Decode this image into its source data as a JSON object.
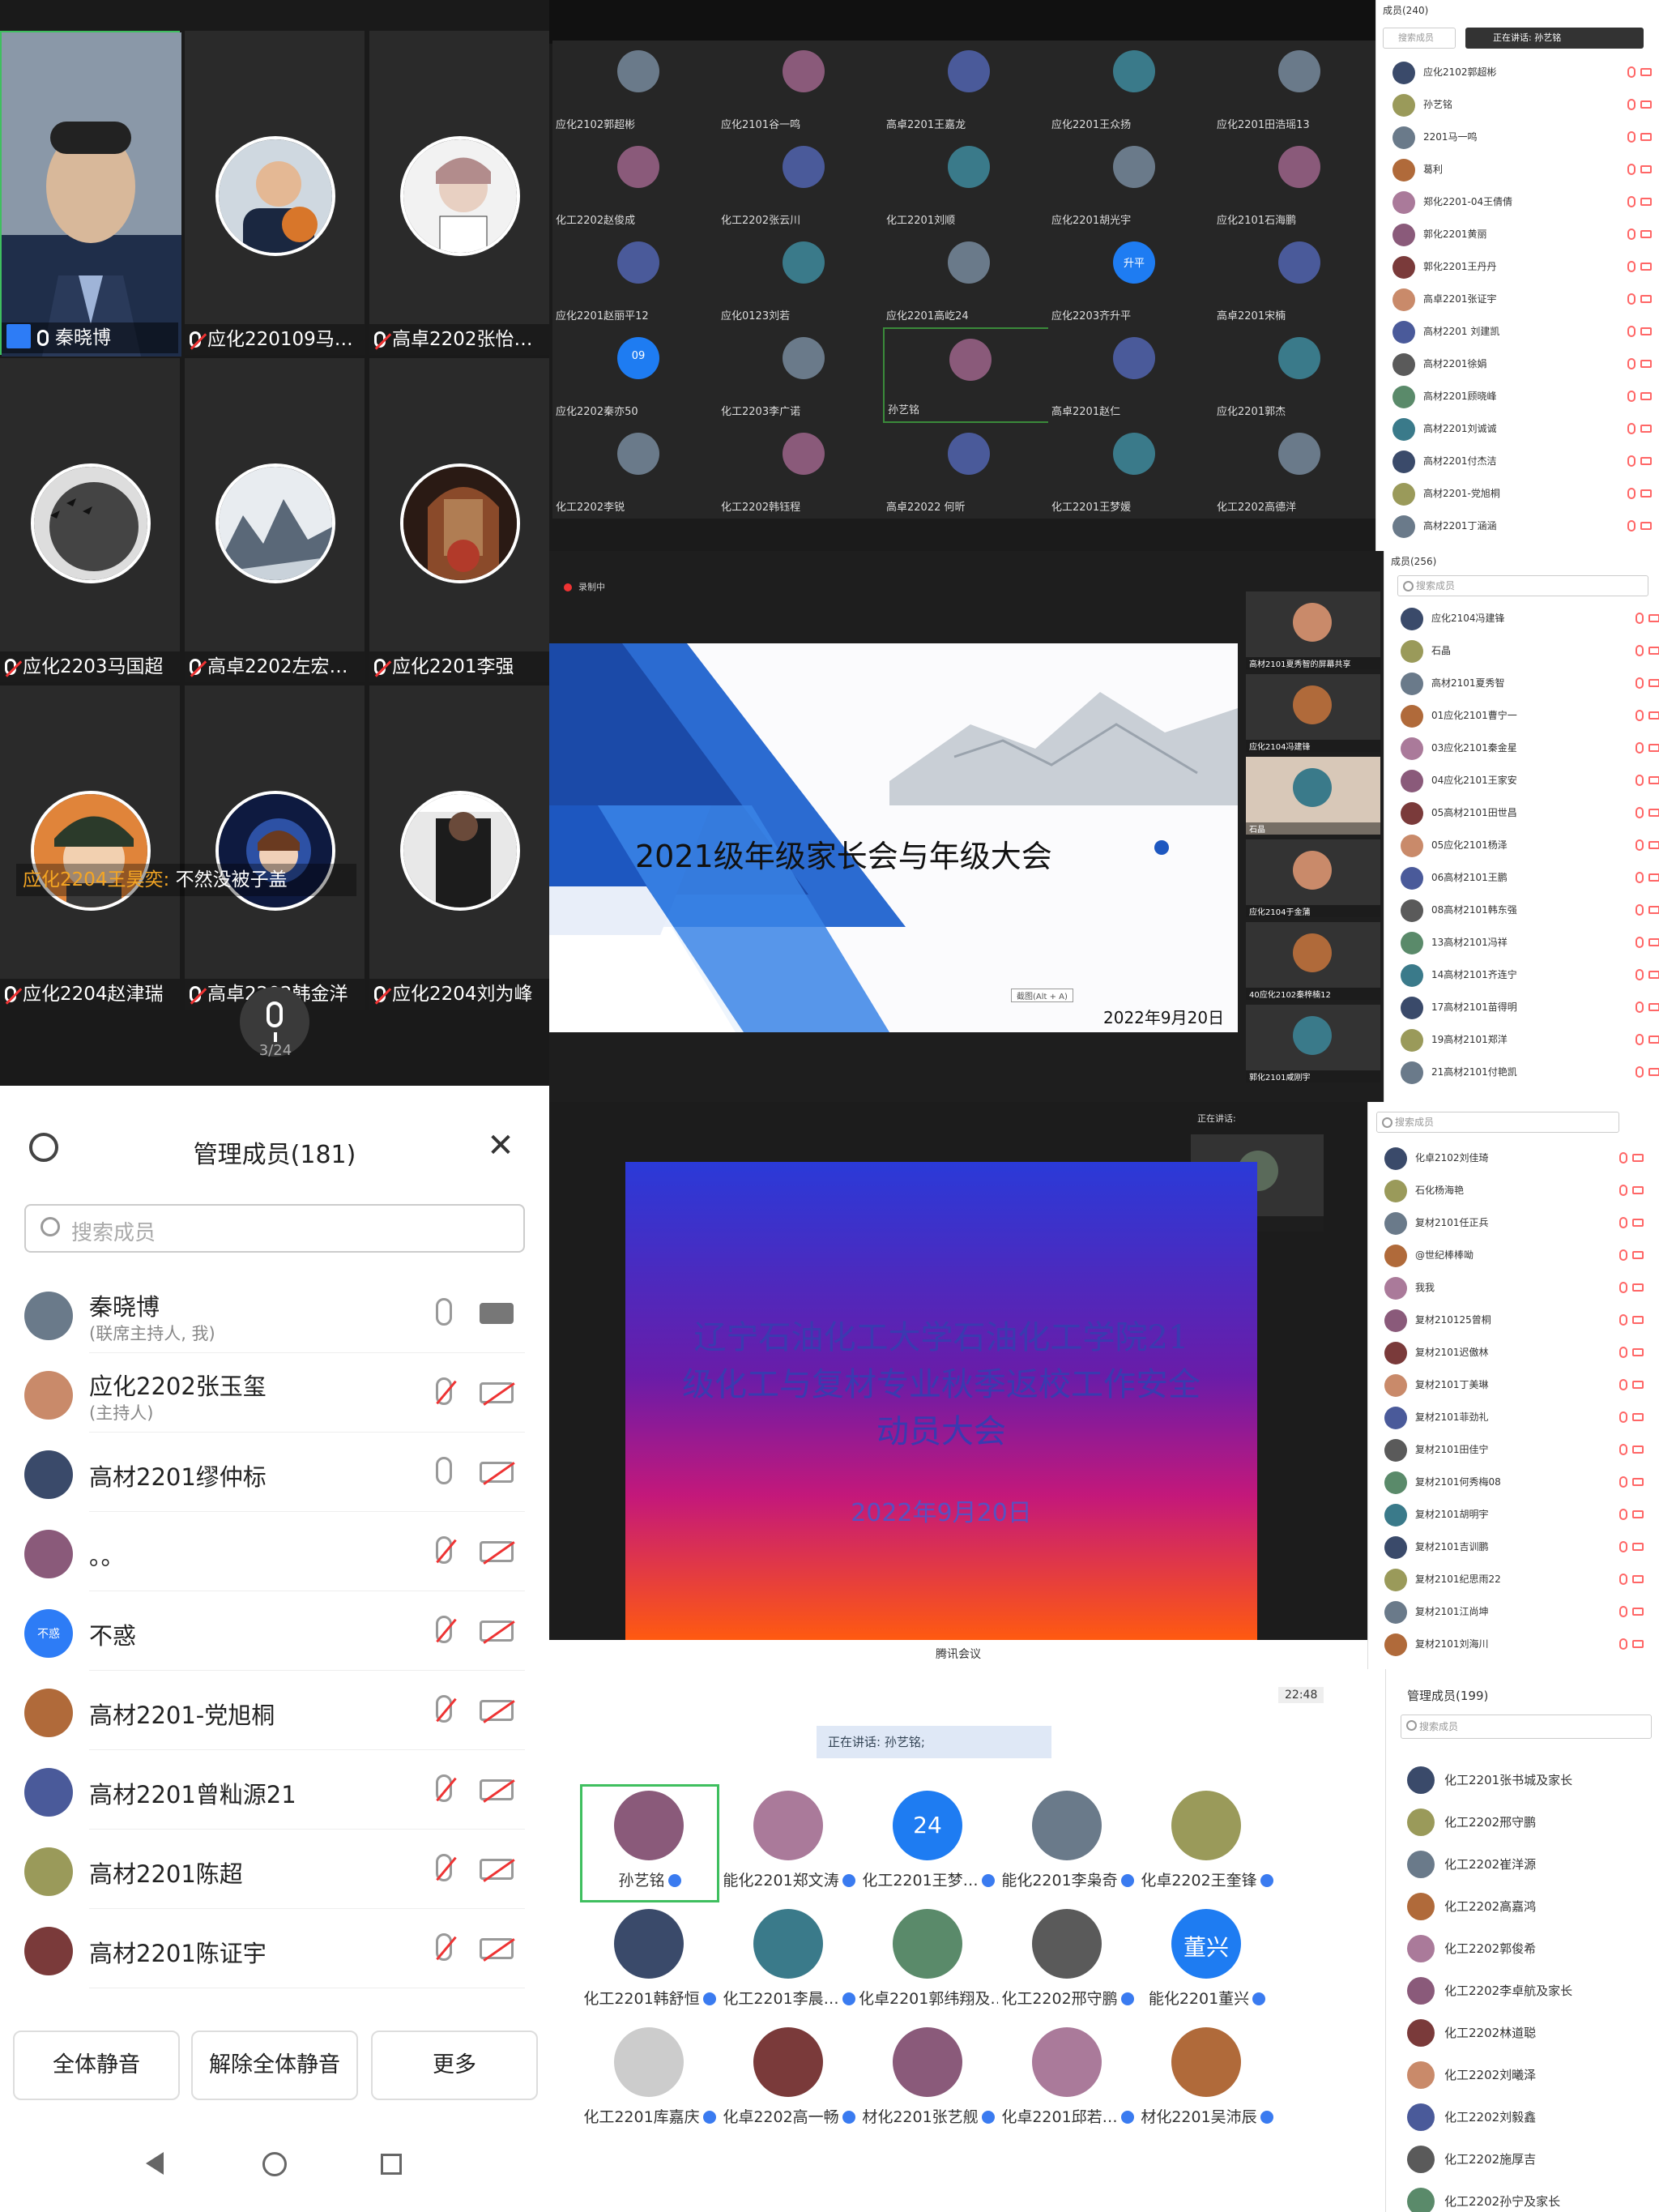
{
  "phone_grid": {
    "tiles": [
      {
        "name": "秦晓博"
      },
      {
        "name": "应化220109马…"
      },
      {
        "name": "高卓2202张怡…"
      },
      {
        "name": "应化2203马国超"
      },
      {
        "name": "高卓2202左宏…"
      },
      {
        "name": "应化2201李强"
      },
      {
        "name": "应化2204赵津瑞"
      },
      {
        "name": "高卓2202韩金洋"
      },
      {
        "name": "应化2204刘为峰"
      }
    ],
    "chat_sender": "应化2204王昊奕:",
    "chat_text": " 不然没被子盖",
    "page_indicator": "3/24"
  },
  "member_sheet": {
    "title": "管理成员(181)",
    "search_placeholder": "搜索成员",
    "members": [
      {
        "name": "秦晓博",
        "sub": "(联席主持人, 我)",
        "mic": "on",
        "cam": "on"
      },
      {
        "name": "应化2202张玉玺",
        "sub": "(主持人)",
        "mic": "off",
        "cam": "off"
      },
      {
        "name": "高材2201缪仲标",
        "sub": "",
        "mic": "on",
        "cam": "off"
      },
      {
        "name": "。。",
        "sub": "",
        "mic": "off",
        "cam": "off"
      },
      {
        "name": "不惑",
        "sub": "",
        "mic": "off",
        "cam": "off",
        "avatar_text": "不惑"
      },
      {
        "name": "高材2201-党旭桐",
        "sub": "",
        "mic": "off",
        "cam": "off"
      },
      {
        "name": "高材2201曾籼源21",
        "sub": "",
        "mic": "off",
        "cam": "off"
      },
      {
        "name": "高材2201陈超",
        "sub": "",
        "mic": "off",
        "cam": "off"
      },
      {
        "name": "高材2201陈证宇",
        "sub": "",
        "mic": "off",
        "cam": "off"
      }
    ],
    "buttons": [
      "全体静音",
      "解除全体静音",
      "更多"
    ]
  },
  "desktop_gallery": {
    "cells": [
      "应化2102郭超彬",
      "应化2101谷一鸣",
      "高卓2201王嘉龙",
      "应化2201王众扬",
      "应化2201田浩瑶13",
      "化工2202赵俊成",
      "化工2202张云川",
      "化工2201刘顺",
      "应化2201胡光宇",
      "应化2101石海鹏",
      "应化2201赵丽平12",
      "应化0123刘若",
      "应化2201高屹24",
      "应化2203齐升平",
      "高卓2201宋楠",
      "应化2202秦亦50",
      "化工2203李广诺",
      "孙艺铭",
      "高卓2201赵仁",
      "应化2201郭杰",
      "化工2202李锐",
      "化工2202韩钰程",
      "高卓22022 何昕",
      "化工2201王梦媛",
      "化工2202高德洋"
    ],
    "bubble_upgrade": "升平",
    "bubble_09": "09",
    "list_title": "成员(240)",
    "list_speaking": "正在讲话: 孙艺铭",
    "list_items": [
      "应化2102郭超彬",
      "孙艺铭",
      "2201马一鸣",
      "葛利",
      "郑化2201-04王倩倩",
      "郭化2201黄丽",
      "郭化2201王丹丹",
      "高卓2201张证宇",
      "高材2201 刘建凯",
      "高材2201徐娟",
      "高材2201顾晓峰",
      "高材2201刘诚诚",
      "高材2201付杰洁",
      "高材2201-党旭桐",
      "高材2201丁涵涵"
    ]
  },
  "slide1": {
    "recording": "录制中",
    "title": "2021级年级家长会与年级大会",
    "date": "2022年9月20日",
    "shortcut": "截图(Alt + A)",
    "thumbs": [
      "高材2101夏秀智的屏幕共享",
      "应化2104冯建锋",
      "石晶",
      "应化2104于金蒲",
      "40应化2102秦梓楠12",
      "郭化2101咸刚宇"
    ],
    "list_title": "成员(256)",
    "search": "搜索成员",
    "list_items": [
      "应化2104冯建锋",
      "石晶",
      "高材2101夏秀智",
      "01应化2101曹宁一",
      "03应化2101秦金星",
      "04应化2101王家安",
      "05高材2101田世昌",
      "05应化2101杨泽",
      "06高材2101王鹏",
      "08高材2101韩东强",
      "13高材2101冯祥",
      "14高材2101齐连宁",
      "17高材2101苗得明",
      "19高材2101郑洋",
      "21高材2101付艳凯"
    ]
  },
  "slide2": {
    "speaking": "正在讲话:",
    "speaker": "石化杨海艳",
    "title": "辽宁石油化工大学石油化工学院21级化工与复材专业秋季返校工作安全动员大会",
    "date": "2022年9月20日",
    "app_name": "腾讯会议",
    "search": "搜索成员",
    "list_items": [
      "化卓2102刘佳琦",
      "石化杨海艳",
      "复材2101任正兵",
      "@世纪棒棒呦",
      "我我",
      "复材210125曾桐",
      "复材2101迟傲林",
      "复材2101丁美琳",
      "复材2101菲劲礼",
      "复材2101田佳宁",
      "复材2101何秀梅08",
      "复材2101胡明宇",
      "复材2101吉训鹏",
      "复材2101纪思雨22",
      "复材2101江尚坤",
      "复材2101刘海川"
    ]
  },
  "tencent_gallery": {
    "time": "22:48",
    "speaking": "正在讲话: 孙艺铭;",
    "badge_24": "24",
    "badge_dongxing": "董兴",
    "cells": [
      "孙艺铭",
      "能化2201郑文涛",
      "化工2201王梦…",
      "能化2201李枭奇",
      "化卓2202王奎锋",
      "化工2201韩舒恒",
      "化工2201李晨…",
      "化卓2201郭纬翔及…",
      "化工2202邢守鹏",
      "能化2201董兴",
      "化工2201库嘉庆",
      "化卓2202高一畅",
      "材化2201张艺舰",
      "化卓2201邱若…",
      "材化2201吴沛辰"
    ],
    "list_title": "管理成员(199)",
    "search": "搜索成员",
    "list_items": [
      "化工2201张书城及家长",
      "化工2202邢守鹏",
      "化工2202崔洋源",
      "化工2202高嘉鸿",
      "化工2202郭俊希",
      "化工2202李卓航及家长",
      "化工2202林道聪",
      "化工2202刘曦泽",
      "化工2202刘毅鑫",
      "化工2202施厚吉",
      "化工2202孙宁及家长"
    ]
  }
}
